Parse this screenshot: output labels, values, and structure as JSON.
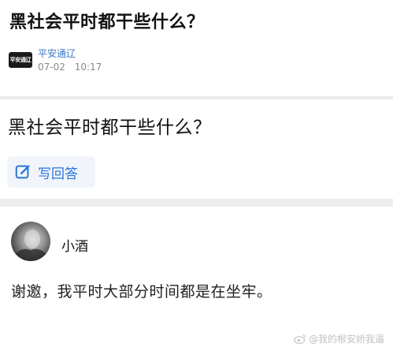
{
  "article": {
    "title": "黑社会平时都干些什么？",
    "source_logo_text": "平安通辽",
    "source_name": "平安通辽",
    "date": "07-02",
    "time": "10:17"
  },
  "question": {
    "title": "黑社会平时都干些什么？",
    "write_answer_label": "写回答"
  },
  "answer": {
    "author": "小酒",
    "text": "谢邀，我平时大部分时间都是在坐牢。"
  },
  "watermark": {
    "text": "@我的根安娇我逼"
  },
  "icons": {
    "edit": "edit-icon",
    "weibo": "weibo-icon"
  },
  "colors": {
    "link_blue": "#3a78c9",
    "button_blue": "#2b74d8",
    "button_bg": "#f1f5fb",
    "divider": "#ececec"
  }
}
